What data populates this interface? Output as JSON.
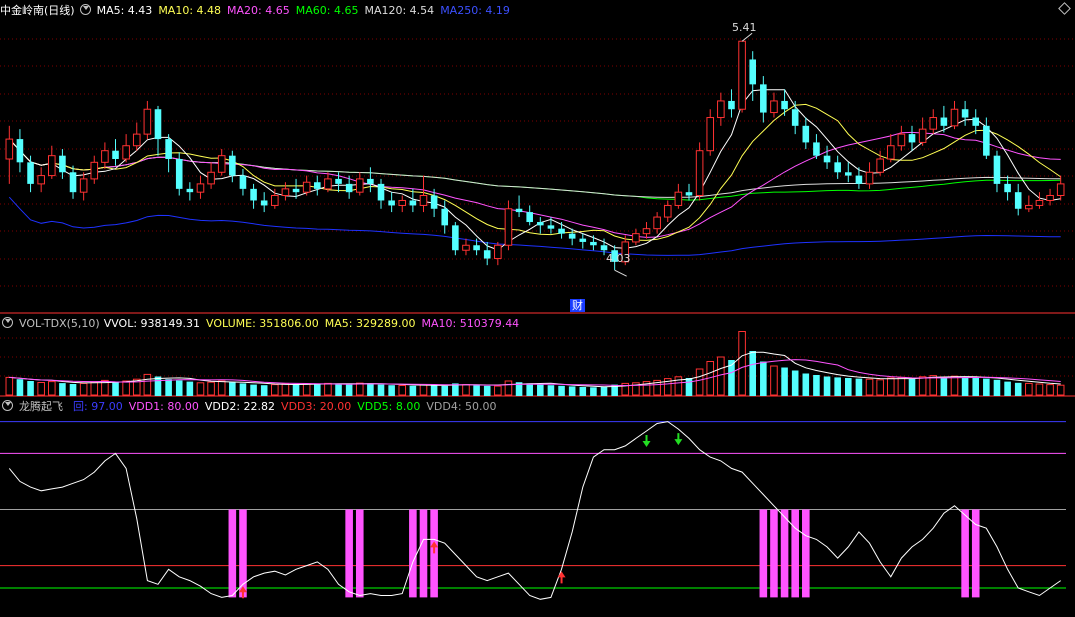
{
  "colors": {
    "up": "#ff3232",
    "down": "#54ffff",
    "ma5": "#ffffff",
    "ma10": "#ffff54",
    "ma20": "#ff54ff",
    "ma60": "#00ff00",
    "ma120": "#dcdcdc",
    "ma250": "#1e32ff",
    "vdd1": "#ff54ff",
    "vdd3": "#ff3232",
    "vdd5": "#00ff00",
    "vdd2": "#ffffff",
    "lineBlue": "#3c3cff",
    "grid": "#800000"
  },
  "header1": {
    "title": "中金岭南(日线)",
    "ma5": "MA5: 4.43",
    "ma10": "MA10: 4.48",
    "ma20": "MA20: 4.65",
    "ma60": "MA60: 4.65",
    "ma120": "MA120: 4.54",
    "ma250": "MA250: 4.19"
  },
  "header2": {
    "name": "VOL-TDX(5,10)",
    "vvol": "VVOL: 938149.31",
    "volume": "VOLUME: 351806.00",
    "ma5": "MA5: 329289.00",
    "ma10": "MA10: 510379.44"
  },
  "header3": {
    "name": "龙腾起飞",
    "v0": "回: 97.00",
    "vdd1": "VDD1: 80.00",
    "vdd2": "VDD2: 22.82",
    "vdd3": "VDD3: 20.00",
    "vdd5": "VDD5: 8.00",
    "vdd4": "VDD4: 50.00"
  },
  "annotations": {
    "high": "5.41",
    "low": "4.03",
    "cai": "财"
  },
  "chart_data": [
    {
      "type": "candlestick",
      "title": "中金岭南(日线)",
      "ylim": [
        3.85,
        5.55
      ],
      "high_label": 5.41,
      "low_label": 4.03,
      "candles": [
        [
          4.7,
          4.82,
          4.9,
          4.55
        ],
        [
          4.82,
          4.68,
          4.88,
          4.62
        ],
        [
          4.68,
          4.55,
          4.72,
          4.5
        ],
        [
          4.55,
          4.6,
          4.65,
          4.5
        ],
        [
          4.6,
          4.72,
          4.78,
          4.58
        ],
        [
          4.72,
          4.62,
          4.76,
          4.58
        ],
        [
          4.62,
          4.5,
          4.66,
          4.46
        ],
        [
          4.5,
          4.58,
          4.62,
          4.45
        ],
        [
          4.58,
          4.68,
          4.72,
          4.55
        ],
        [
          4.68,
          4.75,
          4.8,
          4.64
        ],
        [
          4.75,
          4.7,
          4.82,
          4.66
        ],
        [
          4.7,
          4.78,
          4.85,
          4.68
        ],
        [
          4.78,
          4.85,
          4.92,
          4.75
        ],
        [
          4.85,
          5.0,
          5.05,
          4.82
        ],
        [
          5.0,
          4.82,
          5.02,
          4.72
        ],
        [
          4.82,
          4.7,
          4.85,
          4.62
        ],
        [
          4.7,
          4.52,
          4.74,
          4.48
        ],
        [
          4.52,
          4.5,
          4.56,
          4.45
        ],
        [
          4.5,
          4.55,
          4.6,
          4.46
        ],
        [
          4.55,
          4.62,
          4.68,
          4.52
        ],
        [
          4.62,
          4.72,
          4.76,
          4.6
        ],
        [
          4.72,
          4.6,
          4.75,
          4.56
        ],
        [
          4.6,
          4.52,
          4.64,
          4.48
        ],
        [
          4.52,
          4.45,
          4.55,
          4.4
        ],
        [
          4.45,
          4.42,
          4.5,
          4.38
        ],
        [
          4.42,
          4.48,
          4.52,
          4.4
        ],
        [
          4.48,
          4.52,
          4.56,
          4.45
        ],
        [
          4.52,
          4.5,
          4.58,
          4.46
        ],
        [
          4.5,
          4.56,
          4.6,
          4.48
        ],
        [
          4.56,
          4.52,
          4.6,
          4.48
        ],
        [
          4.52,
          4.58,
          4.62,
          4.5
        ],
        [
          4.58,
          4.55,
          4.62,
          4.5
        ],
        [
          4.55,
          4.5,
          4.6,
          4.46
        ],
        [
          4.5,
          4.58,
          4.62,
          4.48
        ],
        [
          4.58,
          4.55,
          4.65,
          4.5
        ],
        [
          4.55,
          4.45,
          4.58,
          4.4
        ],
        [
          4.45,
          4.42,
          4.5,
          4.38
        ],
        [
          4.42,
          4.45,
          4.48,
          4.38
        ],
        [
          4.45,
          4.42,
          4.52,
          4.38
        ],
        [
          4.42,
          4.48,
          4.6,
          4.38
        ],
        [
          4.48,
          4.4,
          4.52,
          4.35
        ],
        [
          4.4,
          4.3,
          4.45,
          4.25
        ],
        [
          4.3,
          4.15,
          4.32,
          4.12
        ],
        [
          4.15,
          4.18,
          4.22,
          4.12
        ],
        [
          4.18,
          4.15,
          4.22,
          4.12
        ],
        [
          4.15,
          4.1,
          4.2,
          4.06
        ],
        [
          4.1,
          4.18,
          4.2,
          4.06
        ],
        [
          4.18,
          4.4,
          4.45,
          4.15
        ],
        [
          4.4,
          4.38,
          4.48,
          4.35
        ],
        [
          4.38,
          4.32,
          4.42,
          4.3
        ],
        [
          4.32,
          4.3,
          4.35,
          4.25
        ],
        [
          4.3,
          4.28,
          4.35,
          4.25
        ],
        [
          4.28,
          4.25,
          4.32,
          4.22
        ],
        [
          4.25,
          4.22,
          4.28,
          4.18
        ],
        [
          4.22,
          4.2,
          4.25,
          4.16
        ],
        [
          4.2,
          4.18,
          4.24,
          4.15
        ],
        [
          4.18,
          4.15,
          4.22,
          4.12
        ],
        [
          4.15,
          4.08,
          4.18,
          4.03
        ],
        [
          4.08,
          4.2,
          4.24,
          4.06
        ],
        [
          4.2,
          4.25,
          4.28,
          4.18
        ],
        [
          4.25,
          4.28,
          4.32,
          4.22
        ],
        [
          4.28,
          4.35,
          4.38,
          4.25
        ],
        [
          4.35,
          4.42,
          4.45,
          4.32
        ],
        [
          4.42,
          4.5,
          4.55,
          4.4
        ],
        [
          4.5,
          4.48,
          4.55,
          4.45
        ],
        [
          4.48,
          4.75,
          4.8,
          4.45
        ],
        [
          4.75,
          4.95,
          5.0,
          4.72
        ],
        [
          4.95,
          5.05,
          5.1,
          4.9
        ],
        [
          5.05,
          5.0,
          5.12,
          4.95
        ],
        [
          5.0,
          5.41,
          5.41,
          4.98
        ],
        [
          5.3,
          5.15,
          5.35,
          5.05
        ],
        [
          5.15,
          4.98,
          5.2,
          4.92
        ],
        [
          4.98,
          5.05,
          5.1,
          4.95
        ],
        [
          5.05,
          5.0,
          5.12,
          4.96
        ],
        [
          5.0,
          4.9,
          5.05,
          4.85
        ],
        [
          4.9,
          4.8,
          4.95,
          4.76
        ],
        [
          4.8,
          4.72,
          4.85,
          4.7
        ],
        [
          4.72,
          4.68,
          4.78,
          4.64
        ],
        [
          4.68,
          4.62,
          4.72,
          4.58
        ],
        [
          4.62,
          4.6,
          4.68,
          4.56
        ],
        [
          4.6,
          4.55,
          4.65,
          4.52
        ],
        [
          4.55,
          4.62,
          4.68,
          4.52
        ],
        [
          4.62,
          4.7,
          4.75,
          4.6
        ],
        [
          4.7,
          4.78,
          4.85,
          4.68
        ],
        [
          4.78,
          4.85,
          4.9,
          4.75
        ],
        [
          4.85,
          4.8,
          4.9,
          4.75
        ],
        [
          4.8,
          4.88,
          4.95,
          4.78
        ],
        [
          4.88,
          4.95,
          5.0,
          4.85
        ],
        [
          4.95,
          4.9,
          5.02,
          4.86
        ],
        [
          4.9,
          5.0,
          5.05,
          4.88
        ],
        [
          5.0,
          4.95,
          5.05,
          4.9
        ],
        [
          4.95,
          4.9,
          5.0,
          4.85
        ],
        [
          4.9,
          4.72,
          4.95,
          4.7
        ],
        [
          4.72,
          4.55,
          4.75,
          4.5
        ],
        [
          4.55,
          4.5,
          4.6,
          4.45
        ],
        [
          4.5,
          4.4,
          4.55,
          4.36
        ],
        [
          4.4,
          4.42,
          4.48,
          4.38
        ],
        [
          4.42,
          4.45,
          4.5,
          4.4
        ],
        [
          4.45,
          4.48,
          4.52,
          4.42
        ],
        [
          4.48,
          4.55,
          4.6,
          4.45
        ]
      ]
    },
    {
      "type": "bar",
      "title": "VOL-TDX(5,10)",
      "series": [
        {
          "name": "VOLUME",
          "values": [
            620000,
            560000,
            500000,
            450000,
            480000,
            430000,
            400000,
            420000,
            470000,
            520000,
            480000,
            500000,
            560000,
            720000,
            650000,
            560000,
            520000,
            480000,
            440000,
            460000,
            500000,
            460000,
            420000,
            380000,
            360000,
            380000,
            400000,
            390000,
            410000,
            400000,
            420000,
            410000,
            390000,
            430000,
            420000,
            380000,
            360000,
            350000,
            340000,
            380000,
            360000,
            340000,
            420000,
            380000,
            360000,
            340000,
            330000,
            500000,
            460000,
            420000,
            380000,
            360000,
            340000,
            320000,
            300000,
            290000,
            300000,
            380000,
            420000,
            440000,
            480000,
            520000,
            580000,
            640000,
            600000,
            900000,
            1150000,
            1300000,
            1200000,
            2150000,
            1500000,
            1150000,
            1000000,
            950000,
            850000,
            750000,
            700000,
            650000,
            620000,
            600000,
            580000,
            560000,
            540000,
            600000,
            620000,
            580000,
            640000,
            680000,
            640000,
            660000,
            620000,
            600000,
            580000,
            540000,
            480000,
            440000,
            420000,
            400000,
            380000,
            360000
          ]
        }
      ],
      "ma5_last": 329289.0,
      "ma10_last": 510379.44
    },
    {
      "type": "line",
      "title": "龙腾起飞",
      "ylim": [
        0,
        100
      ],
      "levels": {
        "VDD1": 80,
        "VDD4": 50,
        "VDD3": 20,
        "VDD5": 8,
        "top": 97
      },
      "series": [
        {
          "name": "VDD2",
          "values": [
            72,
            65,
            62,
            60,
            61,
            62,
            64,
            66,
            70,
            76,
            80,
            72,
            45,
            12,
            10,
            18,
            14,
            12,
            9,
            5,
            3,
            4,
            10,
            14,
            16,
            17,
            15,
            18,
            20,
            22,
            18,
            10,
            6,
            4,
            5,
            4,
            4,
            5,
            22,
            34,
            34,
            32,
            26,
            20,
            14,
            12,
            14,
            16,
            10,
            4,
            2,
            3,
            18,
            38,
            62,
            78,
            82,
            82,
            84,
            88,
            92,
            96,
            97,
            93,
            88,
            82,
            78,
            76,
            72,
            70,
            64,
            58,
            52,
            46,
            40,
            36,
            34,
            30,
            24,
            30,
            38,
            32,
            22,
            14,
            24,
            30,
            34,
            40,
            48,
            52,
            47,
            42,
            40,
            30,
            18,
            8,
            6,
            4,
            8,
            12
          ]
        }
      ],
      "magenta_bar_indices": [
        21,
        22,
        32,
        33,
        38,
        39,
        40,
        71,
        72,
        73,
        74,
        75,
        90,
        91
      ],
      "red_up_arrow_indices": [
        22,
        40,
        52
      ],
      "green_down_arrow_indices": [
        60,
        63
      ]
    }
  ]
}
